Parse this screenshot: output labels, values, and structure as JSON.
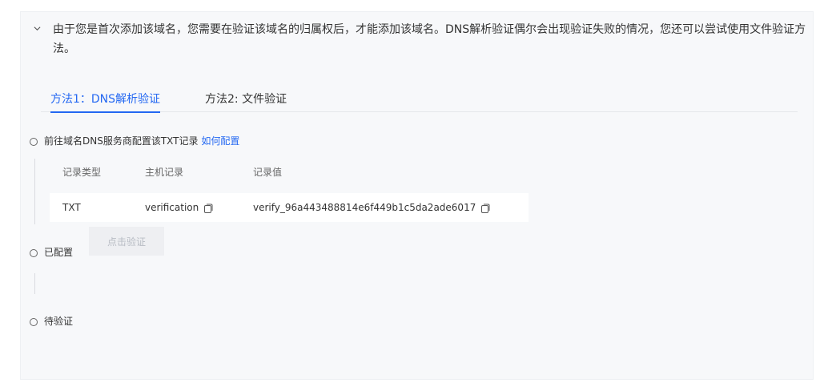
{
  "notice": {
    "text": "由于您是首次添加该域名，您需要在验证该域名的归属权后，才能添加该域名。DNS解析验证偶尔会出现验证失败的情况，您还可以尝试使用文件验证方法。"
  },
  "tabs": [
    {
      "label": "方法1：DNS解析验证",
      "active": true
    },
    {
      "label": "方法2: 文件验证",
      "active": false
    }
  ],
  "steps": {
    "configure": {
      "label": "前往域名DNS服务商配置该TXT记录",
      "link": "如何配置"
    },
    "configured": {
      "label": "已配置",
      "button": "点击验证"
    },
    "pending": {
      "label": "待验证"
    }
  },
  "record_table": {
    "headers": [
      "记录类型",
      "主机记录",
      "记录值"
    ],
    "rows": [
      {
        "type": "TXT",
        "host": "verification",
        "value": "verify_96a443488814e6f449b1c5da2ade6017"
      }
    ]
  },
  "colors": {
    "accent": "#2468f2",
    "panel_bg": "#f7f8fa",
    "button_disabled_bg": "#eeeff2"
  },
  "icons": {
    "collapse": "chevron-down-icon",
    "copy": "copy-icon"
  }
}
